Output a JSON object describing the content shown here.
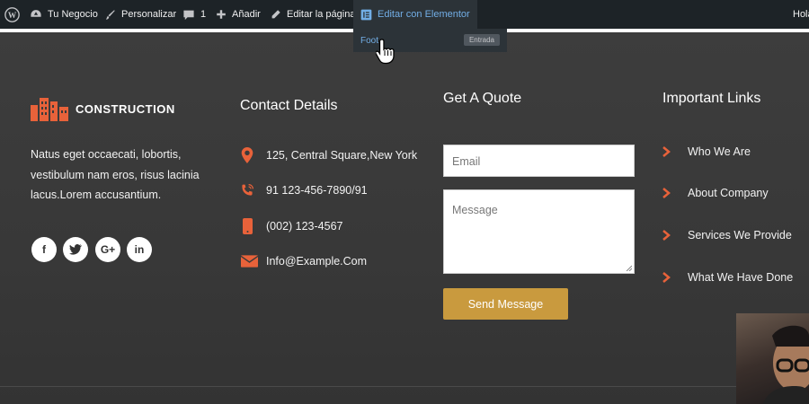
{
  "adminbar": {
    "site_name": "Tu Negocio",
    "customize": "Personalizar",
    "comments_count": "1",
    "add_new": "Añadir",
    "edit_page": "Editar la página",
    "edit_elementor": "Editar con Elementor",
    "greeting": "Hola"
  },
  "dropdown": {
    "item_label": "Foot",
    "item_badge": "Entrada"
  },
  "footer": {
    "logo_text": "CONSTRUCTION",
    "about_text": "Natus eget occaecati, lobortis, vestibulum nam eros, risus lacinia lacus.Lorem accusantium.",
    "social": [
      {
        "label": "f",
        "icon": "facebook-icon"
      },
      {
        "label": "t",
        "icon": "twitter-icon"
      },
      {
        "label": "G+",
        "icon": "google-plus-icon"
      },
      {
        "label": "in",
        "icon": "linkedin-icon"
      }
    ],
    "contact": {
      "heading": "Contact Details",
      "items": [
        {
          "text": "125, Central Square,New York",
          "icon": "map-marker-icon"
        },
        {
          "text": "91 123-456-7890/91",
          "icon": "phone-volume-icon"
        },
        {
          "text": "(002) 123-4567",
          "icon": "mobile-icon"
        },
        {
          "text": "Info@Example.Com",
          "icon": "envelope-icon"
        }
      ]
    },
    "quote": {
      "heading": "Get A Quote",
      "email_placeholder": "Email",
      "message_placeholder": "Message",
      "button_label": "Send Message"
    },
    "links": {
      "heading": "Important Links",
      "items": [
        "Who We Are",
        "About Company",
        "Services We Provide",
        "What We Have Done"
      ]
    }
  },
  "colors": {
    "accent": "#e8623a",
    "button": "#c99a3e",
    "adminbar": "#1d2327",
    "link_blue": "#72aee6"
  }
}
